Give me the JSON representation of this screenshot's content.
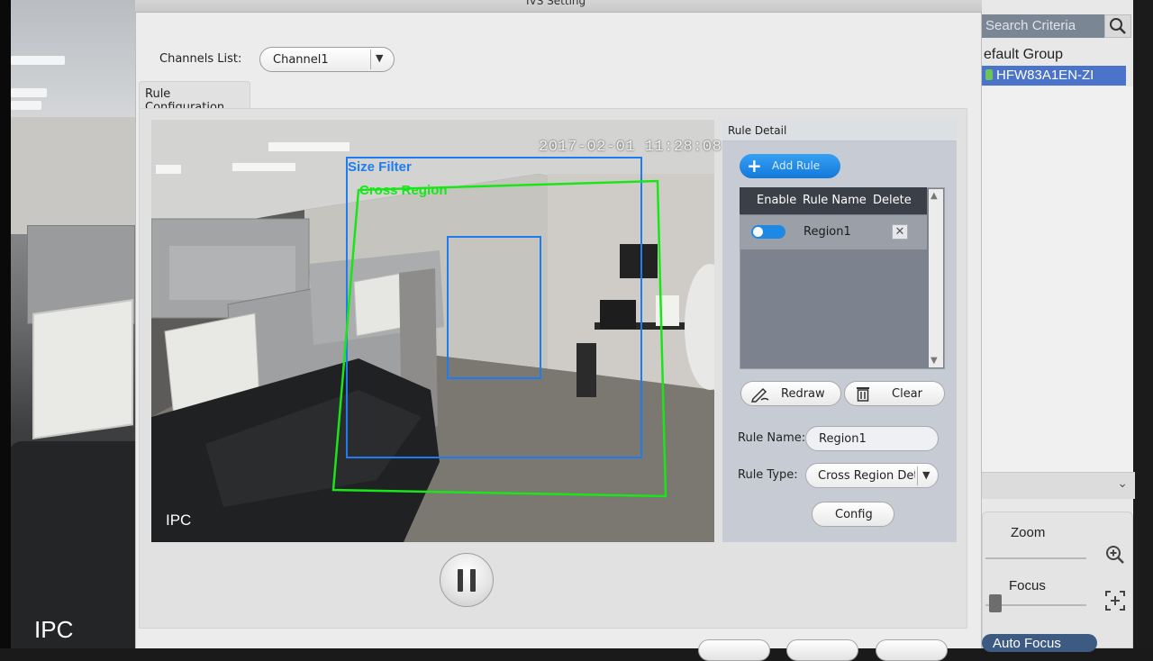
{
  "dialog": {
    "title": "IVS Setting",
    "channels_label": "Channels List:",
    "channel_value": "Channel1",
    "tab_label": "Rule Configuration"
  },
  "video": {
    "timestamp": "2017-02-01 11:28:08",
    "overlay_label": "IPC",
    "size_filter_label": "Size Filter",
    "cross_region_label": "Cross Region",
    "size_filter_color": "#1e7cf0",
    "cross_region_color": "#19e619"
  },
  "rule_detail": {
    "header": "Rule Detail",
    "add_rule_label": "Add Rule",
    "table_headers": [
      "Enable",
      "Rule Name",
      "Delete"
    ],
    "rows": [
      {
        "enabled": true,
        "name": "Region1"
      }
    ],
    "redraw_label": "Redraw",
    "clear_label": "Clear",
    "rule_name_label": "Rule Name:",
    "rule_name_value": "Region1",
    "rule_type_label": "Rule Type:",
    "rule_type_value": "Cross Region Detection",
    "config_label": "Config"
  },
  "device_panel": {
    "search_placeholder": "Search Criteria",
    "group_label": "efault Group",
    "device_label": "HFW83A1EN-ZI",
    "zoom_label": "Zoom",
    "focus_label": "Focus",
    "autofocus_label": "Auto Focus"
  },
  "background_feed": {
    "overlay_label": "IPC"
  },
  "colors": {
    "accent_blue": "#1478d8",
    "selection_blue": "#4a73c9",
    "panel_bg": "#c7cbd3"
  }
}
